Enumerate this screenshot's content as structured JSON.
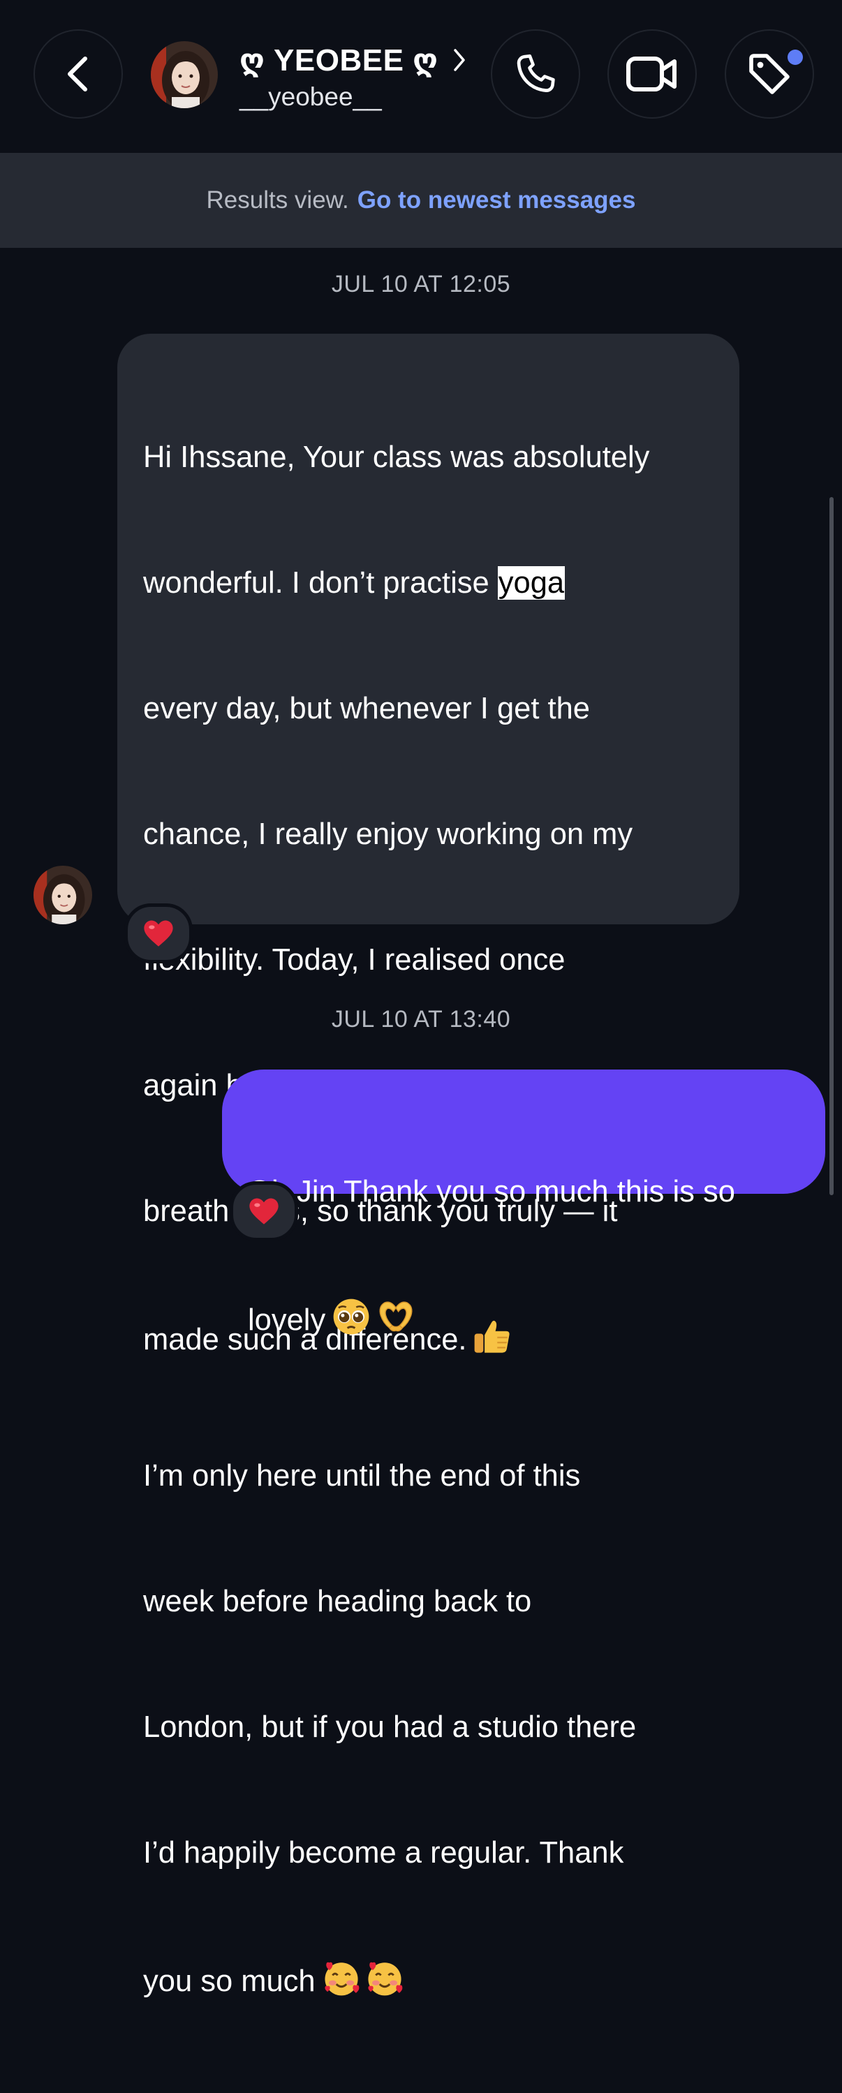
{
  "header": {
    "contact_name": "ღ YEOBEE ღ",
    "username": "__yeobee__",
    "icons": [
      "chevron-left-icon",
      "avatar",
      "chevron-right-icon",
      "phone-icon",
      "video-camera-icon",
      "tag-icon"
    ],
    "notification_dot_color": "#5e7df6"
  },
  "banner": {
    "text": "Results view.",
    "link": "Go to newest messages"
  },
  "messages": [
    {
      "timestamp": "JUL 10 AT 12:05",
      "direction": "incoming",
      "lines": [
        "Hi Ihssane, Your class was absolutely",
        "wonderful. I don’t practise ",
        "yoga",
        "every day, but whenever I get the",
        "chance, I really enjoy working on my",
        "flexibility. Today, I realised once",
        "again how important proper",
        "breathing is, so thank you truly — it",
        "made such a difference.",
        "I’m only here until the end of this",
        "week before heading back to",
        "London, but if you had a studio there",
        "I’d happily become a regular. Thank",
        "you so much"
      ],
      "highlighted_word": "yoga",
      "emojis": [
        "thumbs-up",
        "smiling-face-with-hearts",
        "smiling-face-with-hearts"
      ],
      "reaction": "red-heart",
      "bubble_color": "#262a33"
    },
    {
      "timestamp": "JUL 10 AT 13:40",
      "direction": "outgoing",
      "lines": [
        "Oh Jin Thank you so much this is so",
        "lovely"
      ],
      "emojis": [
        "pleading-face",
        "heart-hands"
      ],
      "reaction": "red-heart",
      "bubble_color": "#6443f4"
    }
  ]
}
